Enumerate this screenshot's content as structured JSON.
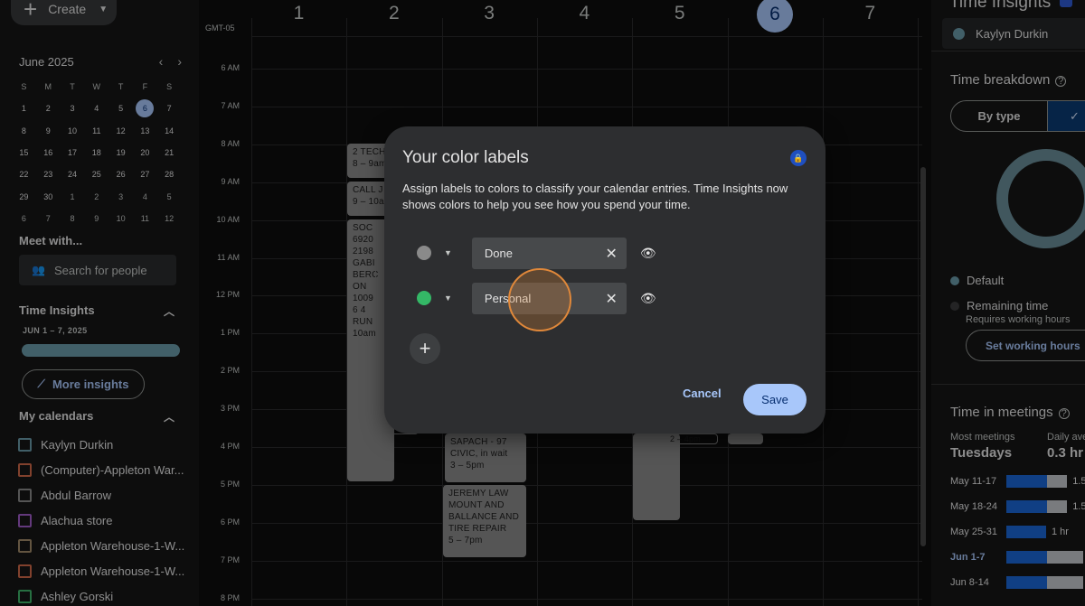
{
  "sidebar": {
    "create_label": "Create",
    "mini_cal": {
      "month": "June 2025",
      "dow": [
        "S",
        "M",
        "T",
        "W",
        "T",
        "F",
        "S"
      ],
      "weeks": [
        [
          "1",
          "2",
          "3",
          "4",
          "5",
          "6",
          "7"
        ],
        [
          "8",
          "9",
          "10",
          "11",
          "12",
          "13",
          "14"
        ],
        [
          "15",
          "16",
          "17",
          "18",
          "19",
          "20",
          "21"
        ],
        [
          "22",
          "23",
          "24",
          "25",
          "26",
          "27",
          "28"
        ],
        [
          "29",
          "30",
          "1",
          "2",
          "3",
          "4",
          "5"
        ],
        [
          "6",
          "7",
          "8",
          "9",
          "10",
          "11",
          "12"
        ]
      ],
      "today": "6"
    },
    "meet_with": "Meet with...",
    "search_placeholder": "Search for people",
    "time_insights": {
      "title": "Time Insights",
      "range": "JUN 1 – 7, 2025",
      "more_label": "More insights"
    },
    "my_calendars": {
      "title": "My calendars",
      "items": [
        {
          "name": "Kaylyn Durkin",
          "color": "#6a9aa8"
        },
        {
          "name": "(Computer)-Appleton War...",
          "color": "#d0694a"
        },
        {
          "name": "Abdul Barrow",
          "color": "#8a8a8a"
        },
        {
          "name": "Alachua store",
          "color": "#a05cc9"
        },
        {
          "name": "Appleton Warehouse-1-W...",
          "color": "#a08a6a"
        },
        {
          "name": "Appleton Warehouse-1-W...",
          "color": "#d0694a"
        },
        {
          "name": "Ashley Gorski",
          "color": "#3fb46a"
        }
      ]
    }
  },
  "main": {
    "timezone": "GMT-05",
    "days": [
      "1",
      "2",
      "3",
      "4",
      "5",
      "6",
      "7"
    ],
    "today_index": 5,
    "hours": [
      "6 AM",
      "7 AM",
      "8 AM",
      "9 AM",
      "10 AM",
      "11 AM",
      "12 PM",
      "1 PM",
      "2 PM",
      "3 PM",
      "4 PM",
      "5 PM",
      "6 PM",
      "7 PM",
      "8 PM"
    ],
    "events": {
      "e1": "2 TECH\n8 – 9am",
      "e2": "CALL J\n9 – 10a",
      "e3": "SOC\n6920\n2198\nGABI\nBERC\nON\n1009\n6 4\nRUN\n10am",
      "e4": "SAPACH - 97\nCIVIC, in wait\n3 – 5pm",
      "e5": "JEREMY LAW\nMOUNT AND\nBALLANCE AND\nTIRE REPAIR\n5 – 7pm",
      "e6": "2 – 4pm"
    }
  },
  "right_panel": {
    "title": "Time Insights",
    "person": "Kaylyn Durkin",
    "breakdown_title": "Time breakdown",
    "by_type": "By type",
    "legend_default": "Default",
    "legend_remaining": "Remaining time",
    "requires_hours": "Requires working hours",
    "set_hours": "Set working hours",
    "meetings_title": "Time in meetings",
    "most_meetings_label": "Most meetings",
    "most_meetings_value": "Tuesdays",
    "daily_avg_label": "Daily ave",
    "daily_avg_value": "0.3 hr",
    "weeks": [
      {
        "label": "May 11-17",
        "blue": 0.56,
        "gray": 0.28,
        "val": "1.5",
        "current": false
      },
      {
        "label": "May 18-24",
        "blue": 0.56,
        "gray": 0.28,
        "val": "1.5",
        "current": false
      },
      {
        "label": "May 25-31",
        "blue": 0.55,
        "gray": 0.0,
        "val": "1 hr",
        "current": false
      },
      {
        "label": "Jun 1-7",
        "blue": 0.56,
        "gray": 0.5,
        "val": "",
        "current": true
      },
      {
        "label": "Jun 8-14",
        "blue": 0.56,
        "gray": 0.5,
        "val": "",
        "current": false
      }
    ]
  },
  "dialog": {
    "title": "Your color labels",
    "description": "Assign labels to colors to classify your calendar entries. Time Insights now shows colors to help you see how you spend your time.",
    "labels": [
      {
        "value": "Done",
        "color": "#8a8a8a"
      },
      {
        "value": "Personal",
        "color": "#34b866"
      }
    ],
    "cancel_label": "Cancel",
    "save_label": "Save"
  }
}
